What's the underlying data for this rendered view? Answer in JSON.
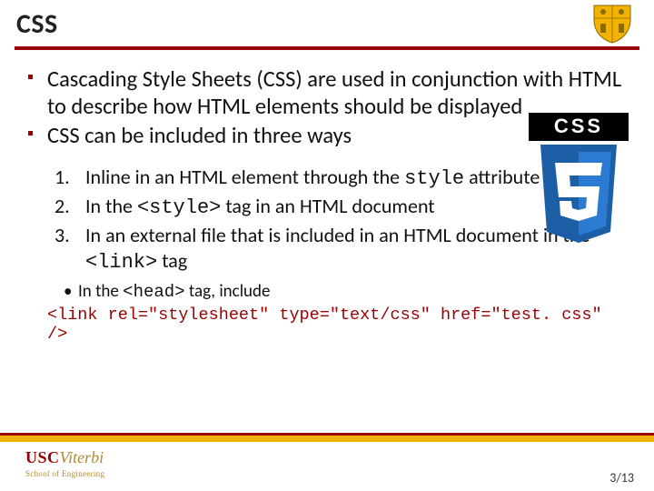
{
  "title": "CSS",
  "bullets": [
    "Cascading Style Sheets (CSS) are used in conjunction with HTML to describe how HTML elements should be displayed",
    "CSS can be included in three ways"
  ],
  "numlist": [
    {
      "pre": "Inline in an HTML element through the ",
      "code": "style",
      "post": " attribute"
    },
    {
      "pre": "In the ",
      "code": "<style>",
      "post": " tag in an HTML document"
    },
    {
      "pre": "In an external file that is included in an HTML document in the ",
      "code": "<link>",
      "post": " tag"
    }
  ],
  "sub": {
    "pre": "In the ",
    "code": "<head>",
    "post": " tag, include"
  },
  "codeline": "<link rel=\"stylesheet\" type=\"text/css\" href=\"test. css\" />",
  "badge": "CSS",
  "logo": {
    "usc": "USC",
    "viterbi": "Viterbi",
    "soe": "School of Engineering"
  },
  "page": "3/13"
}
